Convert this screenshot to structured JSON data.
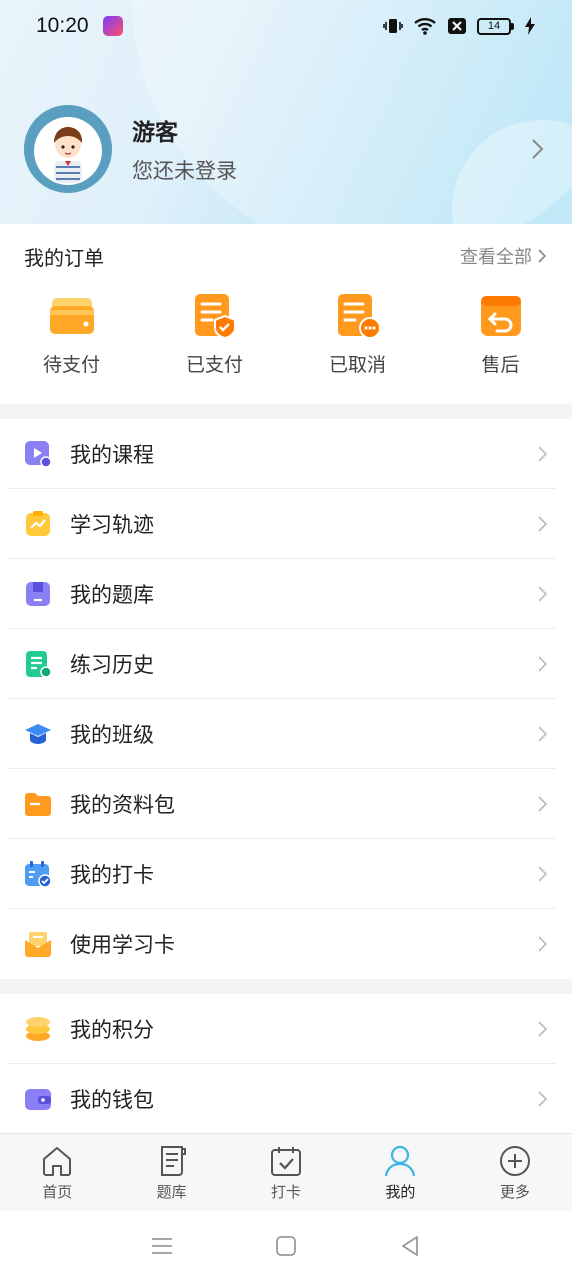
{
  "status_bar": {
    "time": "10:20",
    "battery": "14"
  },
  "profile": {
    "name": "游客",
    "subtitle": "您还未登录"
  },
  "orders": {
    "title": "我的订单",
    "view_all": "查看全部",
    "items": [
      {
        "label": "待支付",
        "icon": "wallet-icon"
      },
      {
        "label": "已支付",
        "icon": "paid-doc-icon"
      },
      {
        "label": "已取消",
        "icon": "cancelled-doc-icon"
      },
      {
        "label": "售后",
        "icon": "return-box-icon"
      }
    ]
  },
  "menu_main": [
    {
      "label": "我的课程",
      "icon": "course-play-icon"
    },
    {
      "label": "学习轨迹",
      "icon": "trend-clipboard-icon"
    },
    {
      "label": "我的题库",
      "icon": "question-bank-icon"
    },
    {
      "label": "练习历史",
      "icon": "history-doc-icon"
    },
    {
      "label": "我的班级",
      "icon": "graduation-cap-icon"
    },
    {
      "label": "我的资料包",
      "icon": "folder-icon"
    },
    {
      "label": "我的打卡",
      "icon": "calendar-check-icon"
    },
    {
      "label": "使用学习卡",
      "icon": "mail-card-icon"
    }
  ],
  "menu_secondary": [
    {
      "label": "我的积分",
      "icon": "coins-icon"
    },
    {
      "label": "我的钱包",
      "icon": "wallet-purple-icon"
    }
  ],
  "tabbar": [
    {
      "label": "首页",
      "icon": "home-icon"
    },
    {
      "label": "题库",
      "icon": "question-list-icon"
    },
    {
      "label": "打卡",
      "icon": "checkin-icon"
    },
    {
      "label": "我的",
      "icon": "user-icon",
      "active": true
    },
    {
      "label": "更多",
      "icon": "plus-circle-icon"
    }
  ],
  "colors": {
    "accent": "#3bb4e6",
    "orange": "#ff9a1f",
    "purple": "#7b6ff0",
    "green": "#22c990"
  }
}
